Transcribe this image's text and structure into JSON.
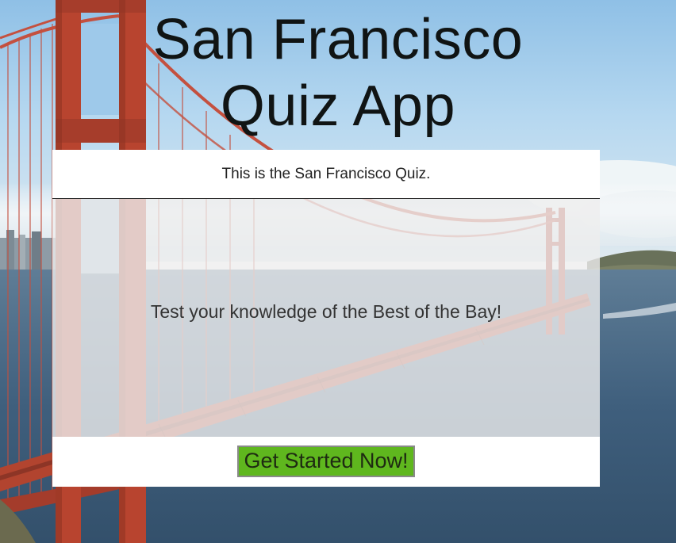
{
  "page": {
    "title_line1": "San Francisco",
    "title_line2": "Quiz App"
  },
  "card": {
    "header_text": "This is the San Francisco Quiz.",
    "body_text": "Test your knowledge of the Best of the Bay!",
    "start_button_label": "Get Started Now!"
  },
  "colors": {
    "title": "#101414",
    "button": "#5fb71e",
    "bridge": "#c0392b",
    "sky": "#9ec9ea",
    "water": "#3d5f80"
  },
  "background": {
    "image": "golden-gate-bridge-photo"
  }
}
